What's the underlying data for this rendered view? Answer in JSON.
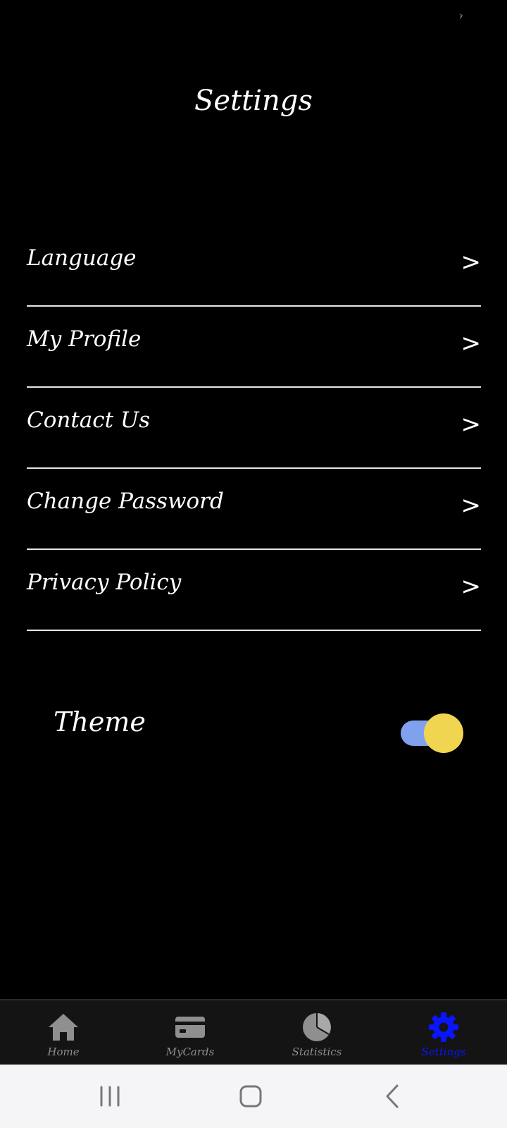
{
  "status_bar": {
    "mark": "ˀ"
  },
  "page": {
    "title": "Settings"
  },
  "menu": {
    "items": [
      {
        "label": "Language",
        "chevron": ">"
      },
      {
        "label": "My Profile",
        "chevron": ">"
      },
      {
        "label": "Contact Us",
        "chevron": ">"
      },
      {
        "label": "Change Password",
        "chevron": ">"
      },
      {
        "label": "Privacy Policy",
        "chevron": ">"
      }
    ]
  },
  "theme": {
    "label": "Theme",
    "toggle_on": true,
    "track_color": "#7fa1ee",
    "thumb_color": "#f0d650"
  },
  "bottom_nav": {
    "active_color": "#0a14ff",
    "inactive_color": "#8f8f8f",
    "items": [
      {
        "label": "Home",
        "icon": "home-icon"
      },
      {
        "label": "MyCards",
        "icon": "card-icon"
      },
      {
        "label": "Statistics",
        "icon": "pie-chart-icon"
      },
      {
        "label": "Settings",
        "icon": "gear-icon",
        "active": true
      }
    ]
  },
  "system_nav": {
    "buttons": [
      "recent-apps-icon",
      "home-button-icon",
      "back-icon"
    ]
  }
}
